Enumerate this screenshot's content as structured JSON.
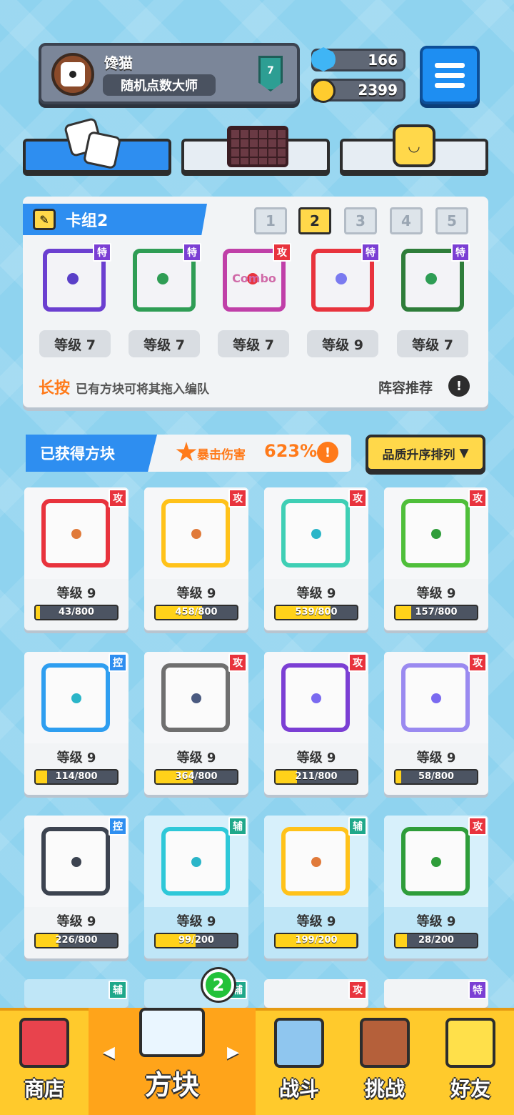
{
  "profile": {
    "name": "馋猫",
    "title": "随机点数大师",
    "rank": "7"
  },
  "resources": {
    "gems": "166",
    "coins": "2399"
  },
  "deck": {
    "label": "卡组2",
    "numbers": [
      "1",
      "2",
      "3",
      "4",
      "5"
    ],
    "active_index": 1,
    "cards": [
      {
        "tag": "特",
        "level": "等级 7",
        "color": "#6b3fd0",
        "pip": "#5a3fc8"
      },
      {
        "tag": "特",
        "level": "等级 7",
        "color": "#2f9d55",
        "pip": "#2f9d55"
      },
      {
        "tag": "攻",
        "level": "等级 7",
        "color": "#c03fa8",
        "pip": "#e8333d",
        "text": "Combo"
      },
      {
        "tag": "特",
        "level": "等级 9",
        "color": "#e8333d",
        "pip": "#7a7af0"
      },
      {
        "tag": "特",
        "level": "等级 7",
        "color": "#2e7d3a",
        "pip": "#2e9d55"
      }
    ],
    "hint_long": "长按",
    "hint_rest": "已有方块可将其拖入编队",
    "recommend": "阵容推荐",
    "info_glyph": "!"
  },
  "owned": {
    "label": "已获得方块",
    "crit_label": "暴击伤害",
    "crit_value": "623%",
    "sort_label": "品质升序排列",
    "sort_arrow": "▼"
  },
  "blocks": [
    {
      "tag": "攻",
      "tag_type": "gong",
      "level": "等级 9",
      "xp": "43/800",
      "progress": 0.054,
      "border": "#e8333d",
      "pip": "#e07a3a",
      "aux": false
    },
    {
      "tag": "攻",
      "tag_type": "gong",
      "level": "等级 9",
      "xp": "458/800",
      "progress": 0.573,
      "border": "#ffc21a",
      "pip": "#e07a3a",
      "aux": false
    },
    {
      "tag": "攻",
      "tag_type": "gong",
      "level": "等级 9",
      "xp": "539/800",
      "progress": 0.674,
      "border": "#3fcfb5",
      "pip": "#2ab5c8",
      "aux": false
    },
    {
      "tag": "攻",
      "tag_type": "gong",
      "level": "等级 9",
      "xp": "157/800",
      "progress": 0.196,
      "border": "#4fbf3a",
      "pip": "#2f9d3a",
      "aux": false
    },
    {
      "tag": "控",
      "tag_type": "kong",
      "level": "等级 9",
      "xp": "114/800",
      "progress": 0.143,
      "border": "#2e9ef0",
      "pip": "#2ab5c8",
      "aux": false
    },
    {
      "tag": "攻",
      "tag_type": "gong",
      "level": "等级 9",
      "xp": "364/800",
      "progress": 0.455,
      "border": "#6f6f6f",
      "pip": "#4a5a80",
      "aux": false
    },
    {
      "tag": "攻",
      "tag_type": "gong",
      "level": "等级 9",
      "xp": "211/800",
      "progress": 0.264,
      "border": "#7b3fd4",
      "pip": "#7a6af0",
      "aux": false
    },
    {
      "tag": "攻",
      "tag_type": "gong",
      "level": "等级 9",
      "xp": "58/800",
      "progress": 0.073,
      "border": "#9a8af0",
      "pip": "#7a6af0",
      "aux": false
    },
    {
      "tag": "控",
      "tag_type": "kong",
      "level": "等级 9",
      "xp": "226/800",
      "progress": 0.283,
      "border": "#3c4350",
      "pip": "#3c4350",
      "aux": false
    },
    {
      "tag": "辅",
      "tag_type": "fu",
      "level": "等级 9",
      "xp": "99/200",
      "progress": 0.495,
      "border": "#2ec8d8",
      "pip": "#2ab5c8",
      "aux": true
    },
    {
      "tag": "辅",
      "tag_type": "fu",
      "level": "等级 9",
      "xp": "199/200",
      "progress": 0.995,
      "border": "#ffc21a",
      "pip": "#e07a3a",
      "aux": true
    },
    {
      "tag": "攻",
      "tag_type": "gong",
      "level": "等级 9",
      "xp": "28/200",
      "progress": 0.14,
      "border": "#2e9d3a",
      "pip": "#2f9d3a",
      "aux": true
    }
  ],
  "partial_row_tags": [
    {
      "tag": "辅",
      "tag_type": "fu"
    },
    {
      "tag": "辅",
      "tag_type": "fu"
    },
    {
      "tag": "攻",
      "tag_type": "gong"
    },
    {
      "tag": "特",
      "tag_type": "te"
    }
  ],
  "nav": {
    "shop": "商店",
    "blocks": "方块",
    "battle": "战斗",
    "challenge": "挑战",
    "friends": "好友",
    "badge": "2",
    "left_arrow": "◀",
    "right_arrow": "▶"
  }
}
